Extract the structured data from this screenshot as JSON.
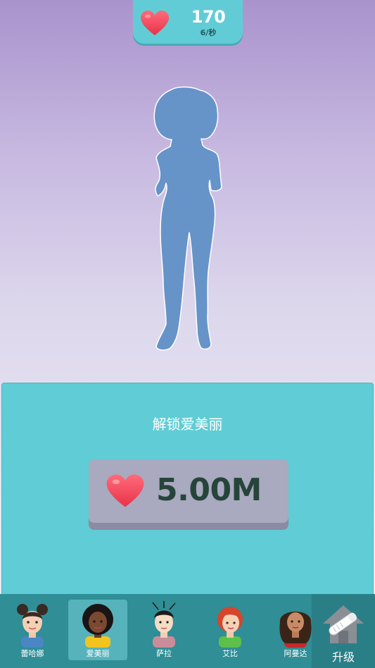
{
  "hud": {
    "hearts_count": "170",
    "hearts_rate": "6/秒",
    "icon": "heart-icon",
    "badge_color": "#62ccd6"
  },
  "silhouette": {
    "icon": "locked-character-silhouette",
    "color": "#6794c8"
  },
  "unlock_panel": {
    "title": "解锁爱美丽",
    "price": "5.00M",
    "panel_color": "#60ccd5",
    "button_color": "#a9a9bf"
  },
  "nav": {
    "characters": [
      {
        "label": "蕾哈娜",
        "selected": false
      },
      {
        "label": "爱美丽",
        "selected": true
      },
      {
        "label": "萨拉",
        "selected": false
      },
      {
        "label": "艾比",
        "selected": false
      },
      {
        "label": "阿曼达",
        "selected": false
      }
    ],
    "upgrade_label": "升级",
    "nav_color": "#2f8e96"
  }
}
